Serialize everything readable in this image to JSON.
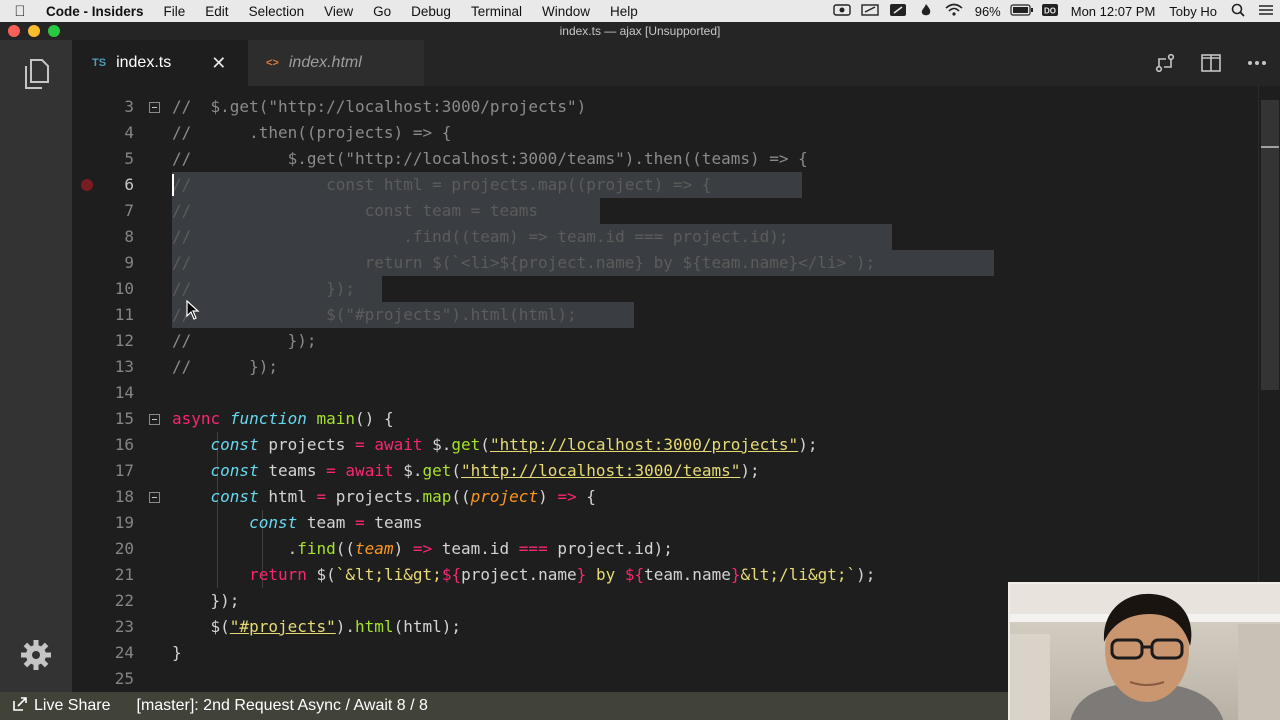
{
  "menubar": {
    "app": "Code - Insiders",
    "items": [
      "File",
      "Edit",
      "Selection",
      "View",
      "Go",
      "Debug",
      "Terminal",
      "Window",
      "Help"
    ],
    "battery": "96%",
    "clock": "Mon 12:07 PM",
    "user": "Toby Ho"
  },
  "window": {
    "title": "index.ts — ajax [Unsupported]"
  },
  "tabs": [
    {
      "icon": "TS",
      "label": "index.ts",
      "active": true,
      "close": "✕"
    },
    {
      "icon": "<>",
      "label": "index.html",
      "active": false
    }
  ],
  "editor": {
    "lines": [
      {
        "n": "3",
        "text": "//  $.get(\"http://localhost:3000/projects\")"
      },
      {
        "n": "4",
        "text": "//      .then((projects) => {"
      },
      {
        "n": "5",
        "text": "//          $.get(\"http://localhost:3000/teams\").then((teams) => {"
      },
      {
        "n": "6",
        "text": "//              const html = projects.map((project) => {"
      },
      {
        "n": "7",
        "text": "//                  const team = teams"
      },
      {
        "n": "8",
        "text": "//                      .find((team) => team.id === project.id);"
      },
      {
        "n": "9",
        "text": "//                  return $(`<li>${project.name} by ${team.name}</li>`);"
      },
      {
        "n": "10",
        "text": "//              });"
      },
      {
        "n": "11",
        "text": "//              $(\"#projects\").html(html);"
      },
      {
        "n": "12",
        "text": "//          });"
      },
      {
        "n": "13",
        "text": "//      });"
      },
      {
        "n": "14",
        "text": ""
      },
      {
        "n": "15",
        "text": "async function main() {"
      },
      {
        "n": "16",
        "text": "    const projects = await $.get(\"http://localhost:3000/projects\");"
      },
      {
        "n": "17",
        "text": "    const teams = await $.get(\"http://localhost:3000/teams\");"
      },
      {
        "n": "18",
        "text": "    const html = projects.map((project) => {"
      },
      {
        "n": "19",
        "text": "        const team = teams"
      },
      {
        "n": "20",
        "text": "            .find((team) => team.id === project.id);"
      },
      {
        "n": "21",
        "text": "        return $(`<li>${project.name} by ${team.name}</li>`);"
      },
      {
        "n": "22",
        "text": "    });"
      },
      {
        "n": "23",
        "text": "    $(\"#projects\").html(html);"
      },
      {
        "n": "24",
        "text": "}"
      },
      {
        "n": "25",
        "text": ""
      }
    ]
  },
  "statusbar": {
    "live_share": "Live Share",
    "branch": "[master]: 2nd Request Async / Await 8 / 8"
  },
  "colors": {
    "statusbar": "#414339",
    "editor_bg": "#1e1e1e",
    "selection": "#3a3d41",
    "keyword": "#f92672",
    "function": "#a6e22e",
    "string": "#e6db74"
  }
}
